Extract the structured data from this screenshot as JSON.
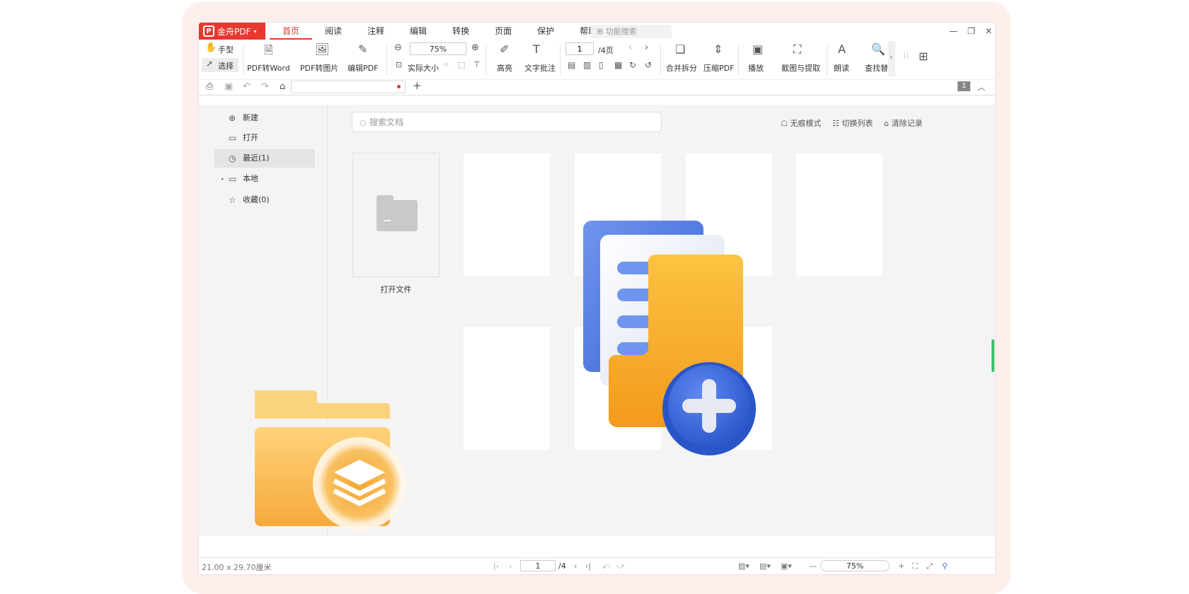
{
  "app": {
    "brand": "金舟PDF",
    "logo_letter": "P"
  },
  "menu": {
    "tabs": [
      "首页",
      "阅读",
      "注释",
      "编辑",
      "转换",
      "页面",
      "保护",
      "帮助"
    ],
    "feature_search_placeholder": "功能搜索"
  },
  "ribbon": {
    "hand": "手型",
    "select": "选择",
    "pdf_to_word": "PDF转Word",
    "pdf_to_image": "PDF转图片",
    "edit_pdf": "编辑PDF",
    "zoom": "75%",
    "actual_size": "实际大小",
    "highlight": "高亮",
    "text_annotation": "文字批注",
    "page_current": "1",
    "page_total": "/4页",
    "merge_split": "合并拆分",
    "compress": "压缩PDF",
    "play": "播放",
    "screenshot_extract": "截图与提取",
    "read_aloud": "朗读",
    "find_replace": "查找替"
  },
  "quickbar": {
    "page_badge": "1"
  },
  "sidebar": {
    "items": [
      {
        "label": "新建"
      },
      {
        "label": "打开"
      },
      {
        "label": "最近(1)"
      },
      {
        "label": "本地"
      },
      {
        "label": "收藏(0)"
      }
    ]
  },
  "main": {
    "search_placeholder": "搜索文档",
    "actions": [
      "无痕模式",
      "切换列表",
      "清除记录"
    ],
    "open_file_label": "打开文件"
  },
  "status": {
    "page_size": "21.00 x 29.70厘米",
    "page_current": "1",
    "page_total": "/4",
    "zoom": "75%"
  },
  "colors": {
    "accent": "#e8382f",
    "scroll": "#3ac06a",
    "folder_orange": "#f5a623",
    "doc_blue": "#3f6fd8"
  }
}
